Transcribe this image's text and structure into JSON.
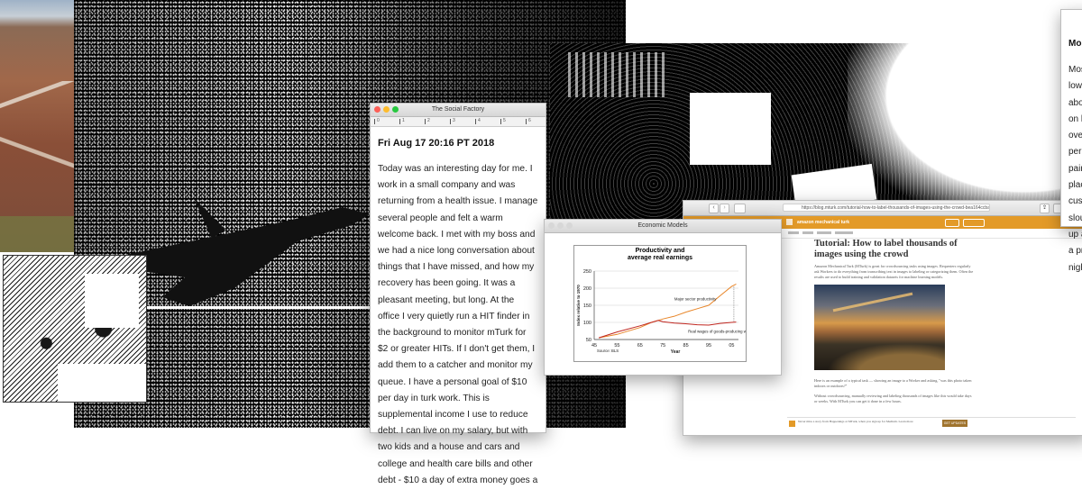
{
  "textedit": {
    "title": "The Social Factory",
    "ruler_numbers": [
      "0",
      "1",
      "2",
      "3",
      "4",
      "5",
      "6"
    ],
    "date": "Fri Aug 17 20:16 PT 2018",
    "body": "Today was an interesting day for me. I work in a small company and was returning from a health issue. I manage several people and felt a warm welcome back. I met with my boss and we had a nice long conversation about things that I have missed, and how my recovery has been going. It was a pleasant meeting, but long. At the office I very quietly run a HIT finder in the background to monitor mTurk for $2 or greater HITs. If I don't get them, I add them to a catcher and monitor my queue. I have a personal goal of $10 per day in turk work. This is supplemental income I use to reduce debt. I can live on my salary, but with two kids and a house and cars and college and health care bills and other debt - $10 a day of extra money goes a"
  },
  "econ": {
    "window_title": "Economic Models",
    "chart_title_line1": "Productivity and",
    "chart_title_line2": "average real earnings",
    "annotation_productivity": "Major sector productivity",
    "annotation_wages": "Real wages of goods-producing workers",
    "source": "Source: BLS",
    "colors": {
      "productivity": "#e8862a",
      "wages": "#c0261f"
    }
  },
  "chart_data": {
    "type": "line",
    "title": "Productivity and average real earnings",
    "xlabel": "Year",
    "ylabel": "Index relative to 1970",
    "xlim": [
      45,
      2008
    ],
    "ylim": [
      50,
      250
    ],
    "x_ticks": [
      "45",
      "55",
      "65",
      "75",
      "85",
      "95",
      "05"
    ],
    "y_ticks": [
      "50",
      "100",
      "150",
      "200",
      "250"
    ],
    "series": [
      {
        "name": "Major sector productivity",
        "x": [
          1947,
          1955,
          1965,
          1970,
          1975,
          1980,
          1985,
          1990,
          1995,
          2000,
          2005,
          2007
        ],
        "y": [
          55,
          65,
          85,
          100,
          110,
          118,
          130,
          140,
          150,
          178,
          205,
          212
        ]
      },
      {
        "name": "Real wages of goods-producing workers",
        "x": [
          1947,
          1955,
          1965,
          1970,
          1973,
          1975,
          1980,
          1985,
          1990,
          1995,
          2000,
          2005,
          2007
        ],
        "y": [
          55,
          72,
          90,
          100,
          106,
          102,
          98,
          96,
          93,
          92,
          97,
          100,
          101
        ]
      }
    ]
  },
  "browser": {
    "url": "https://blog.mturk.com/tutorial-how-to-label-thousands-of-images-using-the-crowd-bea164ccbafd",
    "brand": "amazon mechanical turk",
    "article_title": "Tutorial: How to label thousands of images using the crowd",
    "article_intro": "Amazon Mechanical Turk (MTurk) is great for crowdsourcing tasks using images. Requesters regularly ask Workers to do everything from transcribing text in images to labeling or categorizing them. Often the results are used to build training and validation datasets for machine learning models.",
    "caption": "Here is an example of a typical task — showing an image to a Worker and asking, \"was this photo taken indoors or outdoors?\"",
    "para2": "Without crowdsourcing, manually reviewing and labeling thousands of images like this would take days or weeks. With MTurk you can get it done in a few hours.",
    "footer_text": "Never miss a story from Happenings at MTurk, when you sign up for Medium. Learn more",
    "get_updates": "GET UPDATES"
  },
  "right_doc": {
    "heading": "Mo",
    "lines": [
      "Mos",
      "low",
      "abo",
      "on l",
      "ove",
      "peri",
      "pair",
      "plac",
      "cus",
      "slou",
      "up a",
      "a pr",
      "nigh"
    ]
  }
}
